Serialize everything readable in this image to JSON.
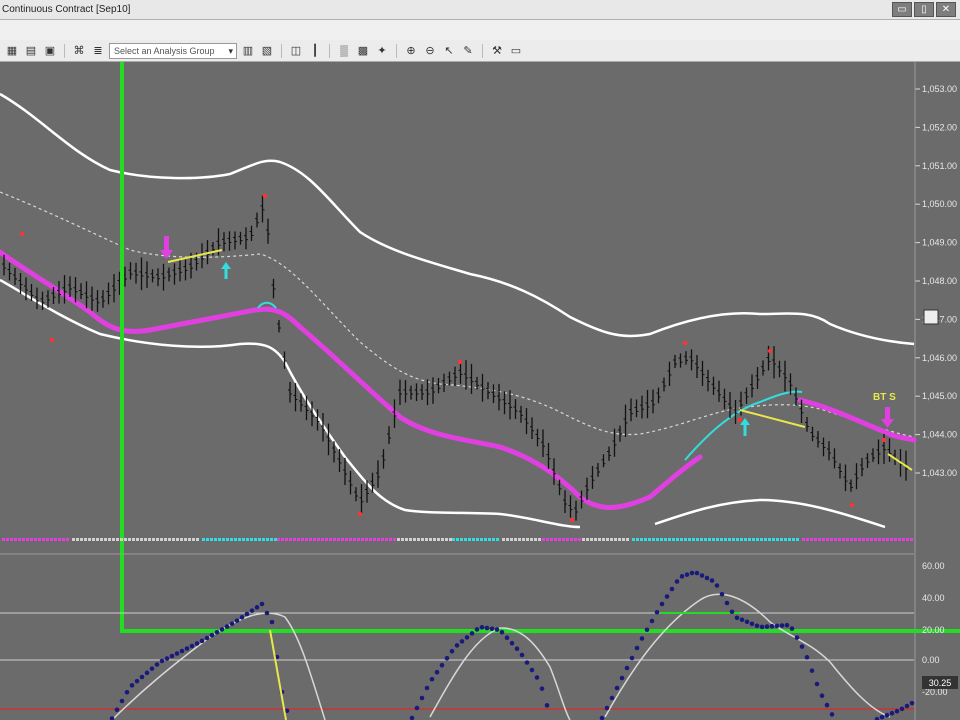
{
  "window": {
    "title": "Continuous Contract [Sep10]",
    "buttons": [
      {
        "name": "restore",
        "glyph": "▭"
      },
      {
        "name": "maximize",
        "glyph": "▯"
      },
      {
        "name": "close",
        "glyph": "✕"
      }
    ]
  },
  "toolbar": {
    "analysis_group_placeholder": "Select an Analysis Group",
    "icons": [
      "grid-icon",
      "table-icon",
      "window-icon",
      "link-icon",
      "analysis-icon",
      "strategy-icon",
      "format-icon",
      "chart-type-icon",
      "bars-icon",
      "candles-icon",
      "line-icon",
      "zoom-in-icon",
      "zoom-out-icon",
      "pointer-icon",
      "drawing-icon",
      "tools-icon",
      "data-window-icon",
      "settings-icon"
    ]
  },
  "price_axis": {
    "labels": [
      "1,053.00",
      "1,052.00",
      "1,051.00",
      "1,050.00",
      "1,049.00",
      "1,048.00",
      "1,047.00",
      "1,046.00",
      "1,045.00",
      "1,044.00",
      "1,043.00"
    ]
  },
  "oscillator_axis": {
    "labels": [
      "60.00",
      "40.00",
      "20.00",
      "0.00",
      "-20.00"
    ],
    "current_value": "30.25"
  },
  "annotations": {
    "signal_label": "BT S"
  },
  "colors": {
    "chart_bg": "#6b6b6b",
    "envelope": "#ffffff",
    "moving_avg": "#e040e0",
    "highlight_frame": "#22dd22",
    "turning_point": "#33dddd",
    "trendline": "#e8e84a",
    "down_marker": "#ff3333"
  }
}
